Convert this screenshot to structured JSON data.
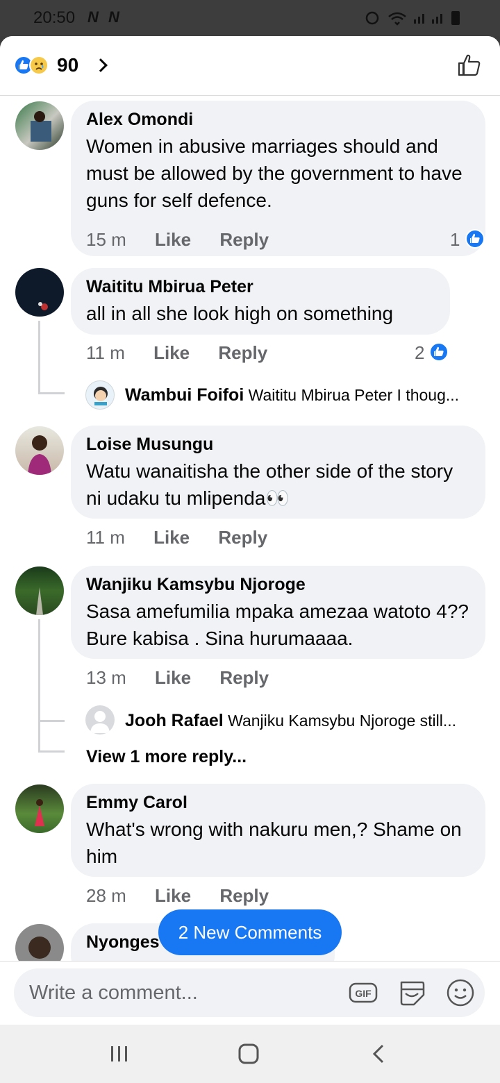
{
  "status_bar": {
    "time": "20:50",
    "left_icons": "N N"
  },
  "header": {
    "reaction_count": "90",
    "reaction_icons": [
      "like-icon",
      "sad-icon"
    ]
  },
  "comments": [
    {
      "name": "Alex Omondi",
      "text": "Women in abusive marriages should and must be allowed by the government to have guns for self defence.",
      "time": "15 m",
      "like": "Like",
      "reply": "Reply",
      "likes": "1"
    },
    {
      "name": "Waititu Mbirua Peter",
      "text": "all in all she look high on something",
      "time": "11 m",
      "like": "Like",
      "reply": "Reply",
      "likes": "2",
      "reply_preview": {
        "name": "Wambui Foifoi",
        "text": "Waititu Mbirua Peter I thoug..."
      }
    },
    {
      "name": "Loise Musungu",
      "text": "Watu wanaitisha the other side of the story ni udaku tu mlipenda👀",
      "time": "11 m",
      "like": "Like",
      "reply": "Reply"
    },
    {
      "name": "Wanjiku Kamsybu Njoroge",
      "text": "Sasa amefumilia mpaka amezaa watoto 4?? Bure kabisa . Sina hurumaaaa.",
      "time": "13 m",
      "like": "Like",
      "reply": "Reply",
      "reply_preview": {
        "name": "Jooh Rafael",
        "text": "Wanjiku Kamsybu Njoroge still..."
      },
      "view_more": "View 1 more reply..."
    },
    {
      "name": "Emmy Carol",
      "text": "What's wrong with nakuru men,? Shame on him",
      "time": "28 m",
      "like": "Like",
      "reply": "Reply"
    },
    {
      "name": "Nyonges"
    }
  ],
  "new_comments_button": "2 New Comments",
  "composer": {
    "placeholder": "Write a comment...",
    "gif_label": "GIF"
  },
  "colors": {
    "accent": "#1877f2",
    "bubble": "#f0f2f5",
    "meta": "#65676b"
  }
}
